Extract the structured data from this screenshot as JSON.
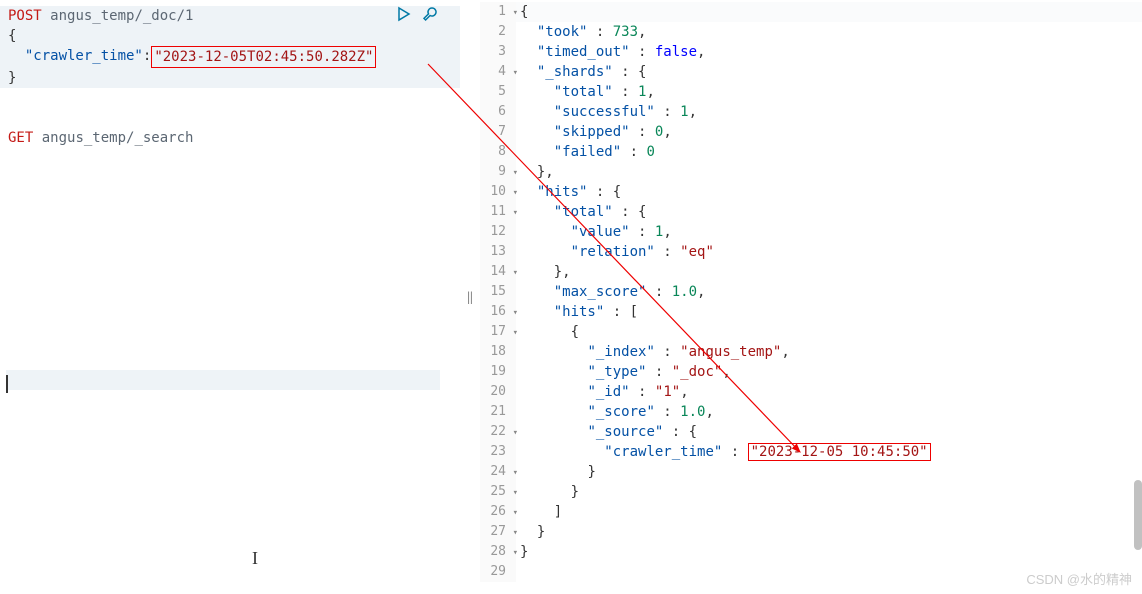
{
  "left": {
    "request1": {
      "method": "POST",
      "path": "angus_temp/_doc/1",
      "body_open": "{",
      "body_line": {
        "indent": "  ",
        "key": "\"crawler_time\"",
        "colon": ":",
        "value": "\"2023-12-05T02:45:50.282Z\""
      },
      "body_close": "}"
    },
    "request2": {
      "method": "GET",
      "path": "angus_temp/_search"
    }
  },
  "right": {
    "lines": [
      {
        "n": "1",
        "fold": true,
        "indent": 0,
        "content": [
          {
            "t": "punct",
            "v": "{"
          }
        ]
      },
      {
        "n": "2",
        "indent": 1,
        "content": [
          {
            "t": "prop",
            "v": "\"took\""
          },
          {
            "t": "punct",
            "v": " : "
          },
          {
            "t": "number",
            "v": "733"
          },
          {
            "t": "punct",
            "v": ","
          }
        ]
      },
      {
        "n": "3",
        "indent": 1,
        "content": [
          {
            "t": "prop",
            "v": "\"timed_out\""
          },
          {
            "t": "punct",
            "v": " : "
          },
          {
            "t": "bool",
            "v": "false"
          },
          {
            "t": "punct",
            "v": ","
          }
        ]
      },
      {
        "n": "4",
        "fold": true,
        "indent": 1,
        "content": [
          {
            "t": "prop",
            "v": "\"_shards\""
          },
          {
            "t": "punct",
            "v": " : {"
          }
        ]
      },
      {
        "n": "5",
        "indent": 2,
        "content": [
          {
            "t": "prop",
            "v": "\"total\""
          },
          {
            "t": "punct",
            "v": " : "
          },
          {
            "t": "number",
            "v": "1"
          },
          {
            "t": "punct",
            "v": ","
          }
        ]
      },
      {
        "n": "6",
        "indent": 2,
        "content": [
          {
            "t": "prop",
            "v": "\"successful\""
          },
          {
            "t": "punct",
            "v": " : "
          },
          {
            "t": "number",
            "v": "1"
          },
          {
            "t": "punct",
            "v": ","
          }
        ]
      },
      {
        "n": "7",
        "indent": 2,
        "content": [
          {
            "t": "prop",
            "v": "\"skipped\""
          },
          {
            "t": "punct",
            "v": " : "
          },
          {
            "t": "number",
            "v": "0"
          },
          {
            "t": "punct",
            "v": ","
          }
        ]
      },
      {
        "n": "8",
        "indent": 2,
        "content": [
          {
            "t": "prop",
            "v": "\"failed\""
          },
          {
            "t": "punct",
            "v": " : "
          },
          {
            "t": "number",
            "v": "0"
          }
        ]
      },
      {
        "n": "9",
        "fold": true,
        "indent": 1,
        "content": [
          {
            "t": "punct",
            "v": "},"
          }
        ]
      },
      {
        "n": "10",
        "fold": true,
        "indent": 1,
        "content": [
          {
            "t": "prop",
            "v": "\"hits\""
          },
          {
            "t": "punct",
            "v": " : {"
          }
        ]
      },
      {
        "n": "11",
        "fold": true,
        "indent": 2,
        "content": [
          {
            "t": "prop",
            "v": "\"total\""
          },
          {
            "t": "punct",
            "v": " : {"
          }
        ]
      },
      {
        "n": "12",
        "indent": 3,
        "content": [
          {
            "t": "prop",
            "v": "\"value\""
          },
          {
            "t": "punct",
            "v": " : "
          },
          {
            "t": "number",
            "v": "1"
          },
          {
            "t": "punct",
            "v": ","
          }
        ]
      },
      {
        "n": "13",
        "indent": 3,
        "content": [
          {
            "t": "prop",
            "v": "\"relation\""
          },
          {
            "t": "punct",
            "v": " : "
          },
          {
            "t": "string",
            "v": "\"eq\""
          }
        ]
      },
      {
        "n": "14",
        "fold": true,
        "indent": 2,
        "content": [
          {
            "t": "punct",
            "v": "},"
          }
        ]
      },
      {
        "n": "15",
        "indent": 2,
        "content": [
          {
            "t": "prop",
            "v": "\"max_score\""
          },
          {
            "t": "punct",
            "v": " : "
          },
          {
            "t": "number",
            "v": "1.0"
          },
          {
            "t": "punct",
            "v": ","
          }
        ]
      },
      {
        "n": "16",
        "fold": true,
        "indent": 2,
        "content": [
          {
            "t": "prop",
            "v": "\"hits\""
          },
          {
            "t": "punct",
            "v": " : ["
          }
        ]
      },
      {
        "n": "17",
        "fold": true,
        "indent": 3,
        "content": [
          {
            "t": "punct",
            "v": "{"
          }
        ]
      },
      {
        "n": "18",
        "indent": 4,
        "content": [
          {
            "t": "prop",
            "v": "\"_index\""
          },
          {
            "t": "punct",
            "v": " : "
          },
          {
            "t": "string",
            "v": "\"angus_temp\""
          },
          {
            "t": "punct",
            "v": ","
          }
        ]
      },
      {
        "n": "19",
        "indent": 4,
        "content": [
          {
            "t": "prop",
            "v": "\"_type\""
          },
          {
            "t": "punct",
            "v": " : "
          },
          {
            "t": "string",
            "v": "\"_doc\""
          },
          {
            "t": "punct",
            "v": ","
          }
        ]
      },
      {
        "n": "20",
        "indent": 4,
        "content": [
          {
            "t": "prop",
            "v": "\"_id\""
          },
          {
            "t": "punct",
            "v": " : "
          },
          {
            "t": "string",
            "v": "\"1\""
          },
          {
            "t": "punct",
            "v": ","
          }
        ]
      },
      {
        "n": "21",
        "indent": 4,
        "content": [
          {
            "t": "prop",
            "v": "\"_score\""
          },
          {
            "t": "punct",
            "v": " : "
          },
          {
            "t": "number",
            "v": "1.0"
          },
          {
            "t": "punct",
            "v": ","
          }
        ]
      },
      {
        "n": "22",
        "fold": true,
        "indent": 4,
        "content": [
          {
            "t": "prop",
            "v": "\"_source\""
          },
          {
            "t": "punct",
            "v": " : {"
          }
        ]
      },
      {
        "n": "23",
        "indent": 5,
        "content": [
          {
            "t": "prop",
            "v": "\"crawler_time\""
          },
          {
            "t": "punct",
            "v": " : "
          },
          {
            "t": "string",
            "v": "\"2023-12-05 10:45:50\"",
            "hl": true
          }
        ]
      },
      {
        "n": "24",
        "fold": true,
        "indent": 4,
        "content": [
          {
            "t": "punct",
            "v": "}"
          }
        ]
      },
      {
        "n": "25",
        "fold": true,
        "indent": 3,
        "content": [
          {
            "t": "punct",
            "v": "}"
          }
        ]
      },
      {
        "n": "26",
        "fold": true,
        "indent": 2,
        "content": [
          {
            "t": "punct",
            "v": "]"
          }
        ]
      },
      {
        "n": "27",
        "fold": true,
        "indent": 1,
        "content": [
          {
            "t": "punct",
            "v": "}"
          }
        ]
      },
      {
        "n": "28",
        "fold": true,
        "indent": 0,
        "content": [
          {
            "t": "punct",
            "v": "}"
          }
        ]
      },
      {
        "n": "29",
        "indent": 0,
        "content": []
      }
    ]
  },
  "watermark": "CSDN @水的精神",
  "divider_handle": "‖"
}
